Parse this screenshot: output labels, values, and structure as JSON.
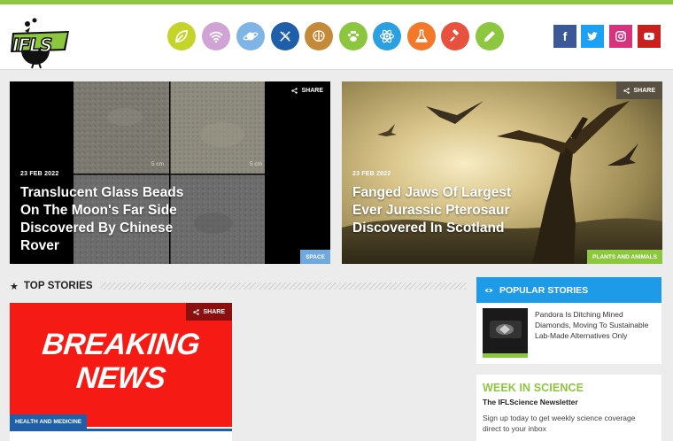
{
  "header": {
    "logo_text": "IFLS",
    "categories": [
      {
        "name": "environment",
        "color": "#c4d42b"
      },
      {
        "name": "technology",
        "color": "#cfa4d4"
      },
      {
        "name": "space",
        "color": "#7fb5e6"
      },
      {
        "name": "health-and-medicine",
        "color": "#1f5ea8"
      },
      {
        "name": "brain",
        "color": "#c48a3a"
      },
      {
        "name": "plants-and-animals",
        "color": "#8cc63f"
      },
      {
        "name": "physics",
        "color": "#2aa0e0"
      },
      {
        "name": "chemistry",
        "color": "#f3792a"
      },
      {
        "name": "policy",
        "color": "#e8513d"
      },
      {
        "name": "editors-blog",
        "color": "#8dc63f"
      }
    ],
    "social": [
      {
        "name": "facebook",
        "label": "f",
        "color": "#3b5998"
      },
      {
        "name": "twitter",
        "color": "#1da1f2"
      },
      {
        "name": "instagram",
        "color": "#d6337c"
      },
      {
        "name": "youtube",
        "color": "#c9201f"
      }
    ]
  },
  "hero": [
    {
      "date": "23 FEB 2022",
      "title": "Translucent Glass Beads On The Moon's Far Side Discovered By Chinese Rover",
      "category": "SPACE",
      "category_color": "#6fa8dc",
      "share": "SHARE",
      "scale_labels": [
        "5 cm",
        "5 cm"
      ]
    },
    {
      "date": "23 FEB 2022",
      "title": "Fanged Jaws Of Largest Ever Jurassic Pterosaur Discovered In Scotland",
      "category": "PLANTS AND ANIMALS",
      "category_color": "#8dc63f",
      "share": "SHARE"
    }
  ],
  "top_stories": {
    "heading": "TOP STORIES",
    "first": {
      "image_line1": "BREAKING",
      "image_line2": "NEWS",
      "category": "HEALTH AND MEDICINE",
      "category_color": "#1f5ea8",
      "share": "SHARE"
    }
  },
  "popular": {
    "heading": "POPULAR STORIES",
    "items": [
      {
        "title": "Pandora Is Ditching Mined Diamonds, Moving To Sustainable Lab-Made Alternatives Only"
      }
    ]
  },
  "newsletter": {
    "heading": "WEEK IN SCIENCE",
    "subheading": "The IFLScience Newsletter",
    "description": "Sign up today to get weekly science coverage direct to your inbox"
  }
}
